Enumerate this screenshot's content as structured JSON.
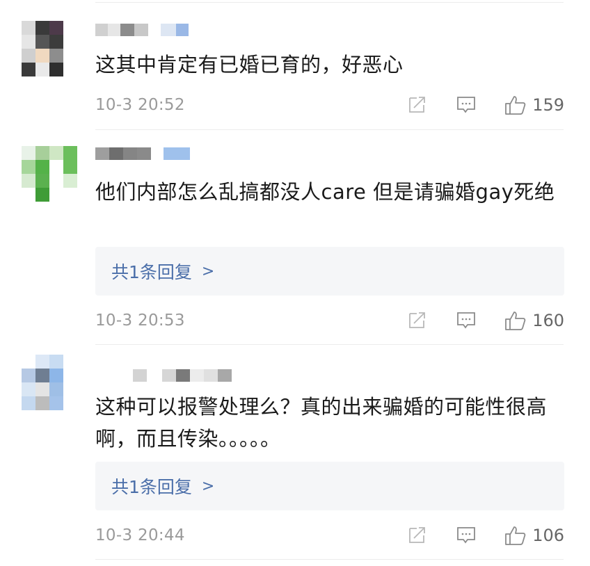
{
  "comments": [
    {
      "text": "这其中肯定有已婚已育的，好恶心",
      "time": "10-3 20:52",
      "likes": "159",
      "replies_label": ""
    },
    {
      "text": "他们内部怎么乱搞都没人care 但是请骗婚gay死绝",
      "time": "10-3 20:53",
      "likes": "160",
      "replies_label": "共1条回复",
      "replies_chevron": ">"
    },
    {
      "text": "这种可以报警处理么？真的出来骗婚的可能性很高啊，而且传染。。。。。",
      "time": "10-3 20:44",
      "likes": "106",
      "replies_label": "共1条回复",
      "replies_chevron": ">"
    }
  ],
  "icons": {
    "share": "share-icon",
    "comment": "comment-icon",
    "like": "thumbs-up-icon"
  },
  "colors": {
    "link": "#4a6ea9",
    "meta": "#9a9a9a",
    "reply_bg": "#f5f6f8",
    "divider": "#ececec"
  }
}
